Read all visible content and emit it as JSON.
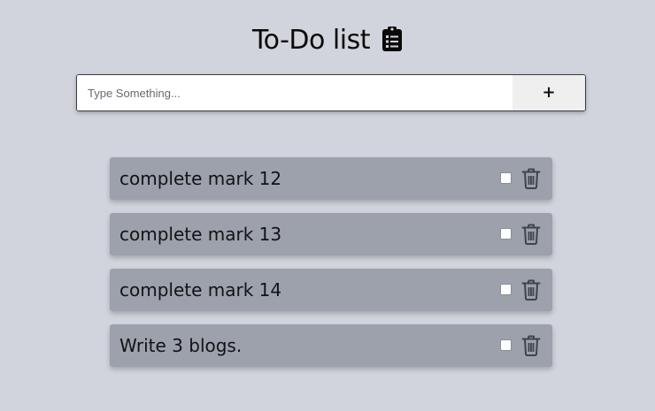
{
  "header": {
    "title": "To-Do list",
    "icon": "clipboard-list-icon"
  },
  "input": {
    "placeholder": "Type Something...",
    "value": "",
    "add_label": "+"
  },
  "todos": [
    {
      "text": "complete mark 12",
      "checked": false
    },
    {
      "text": "complete mark 13",
      "checked": false
    },
    {
      "text": "complete mark 14",
      "checked": false
    },
    {
      "text": "Write 3 blogs.",
      "checked": false
    }
  ],
  "icons": {
    "checkbox": "checkbox-icon",
    "delete": "trash-icon"
  },
  "colors": {
    "background": "#d1d4dc",
    "item_background": "#9ca1ab",
    "add_button": "#efefef",
    "text": "#111316",
    "trash": "#3f434b"
  }
}
